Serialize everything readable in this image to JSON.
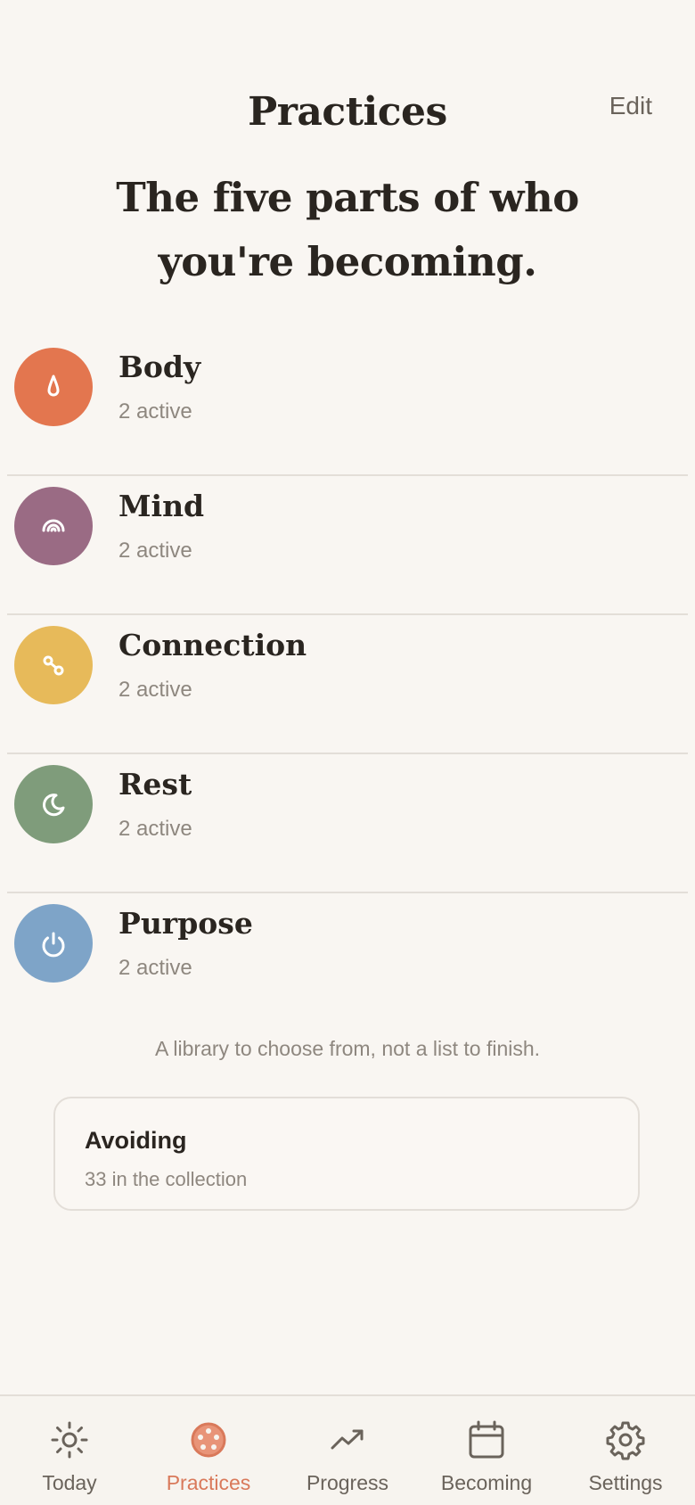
{
  "header": {
    "title": "Practices",
    "edit_label": "Edit"
  },
  "subtitle": "The five parts of who you're becoming.",
  "practices": [
    {
      "name": "Body",
      "status": "2 active",
      "color": "#e3764f",
      "icon": "drop-icon"
    },
    {
      "name": "Mind",
      "status": "2 active",
      "color": "#9a6b84",
      "icon": "rainbow-icon"
    },
    {
      "name": "Connection",
      "status": "2 active",
      "color": "#e7ba5a",
      "icon": "link-icon"
    },
    {
      "name": "Rest",
      "status": "2 active",
      "color": "#7f9c7b",
      "icon": "moon-icon"
    },
    {
      "name": "Purpose",
      "status": "2 active",
      "color": "#7ea4c8",
      "icon": "power-icon"
    }
  ],
  "tagline": "A library to choose from, not a list to finish.",
  "collection_card": {
    "title": "Avoiding",
    "subtitle": "33 in the collection"
  },
  "tabbar": {
    "active_color": "#d9795a",
    "tabs": [
      {
        "label": "Today",
        "icon": "sun-icon"
      },
      {
        "label": "Practices",
        "icon": "practices-icon"
      },
      {
        "label": "Progress",
        "icon": "trend-up-icon"
      },
      {
        "label": "Becoming",
        "icon": "calendar-icon"
      },
      {
        "label": "Settings",
        "icon": "gear-icon"
      }
    ]
  }
}
